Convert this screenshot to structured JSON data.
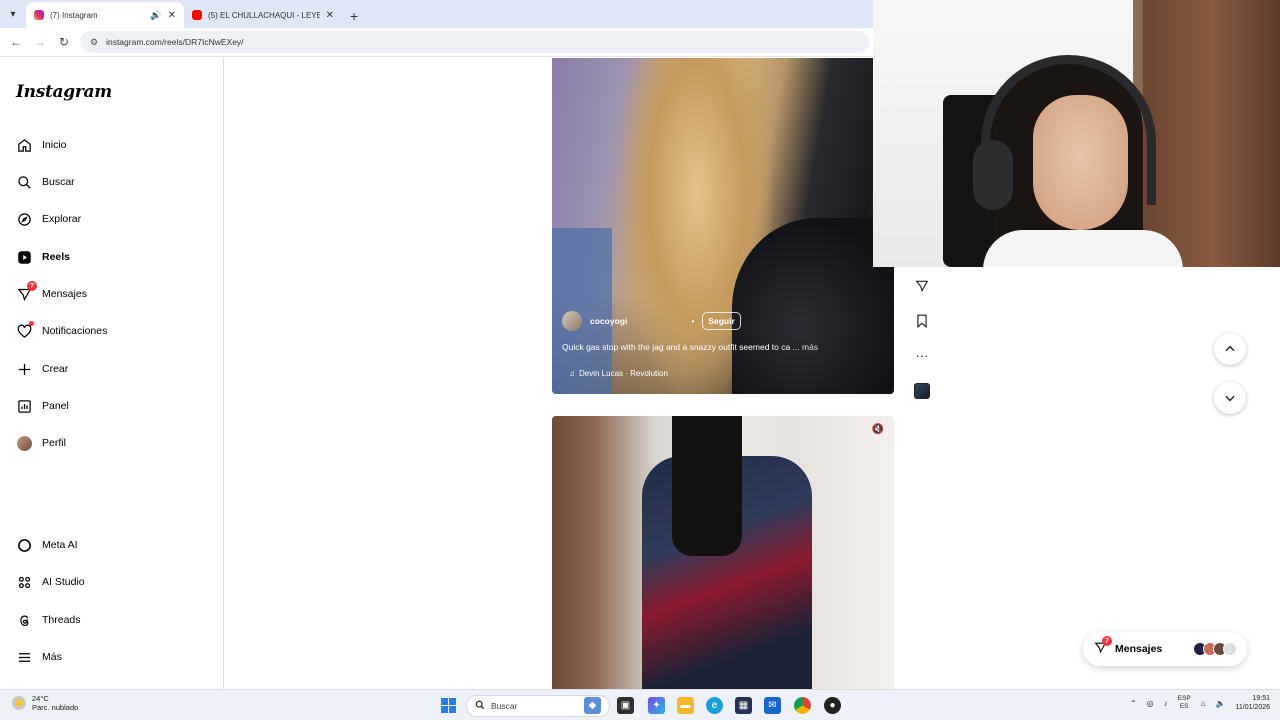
{
  "browser": {
    "tabs": [
      {
        "title": "(7) Instagram",
        "active": true
      },
      {
        "title": "(5) EL CHULLACHAQUI - LEYEN",
        "active": false
      }
    ],
    "url": "instagram.com/reels/DR7IcNwEXey/"
  },
  "sidebar": {
    "logo": "Instagram",
    "items": [
      {
        "label": "Inicio",
        "icon": "home-icon"
      },
      {
        "label": "Buscar",
        "icon": "search-icon"
      },
      {
        "label": "Explorar",
        "icon": "compass-icon"
      },
      {
        "label": "Reels",
        "icon": "reels-icon"
      },
      {
        "label": "Mensajes",
        "icon": "messenger-icon",
        "badge": "7"
      },
      {
        "label": "Notificaciones",
        "icon": "heart-icon"
      },
      {
        "label": "Crear",
        "icon": "plus-icon"
      },
      {
        "label": "Panel",
        "icon": "chart-icon"
      },
      {
        "label": "Perfil",
        "icon": "avatar-icon"
      },
      {
        "label": "Meta AI",
        "icon": "meta-ai-icon"
      },
      {
        "label": "AI Studio",
        "icon": "ai-studio-icon"
      },
      {
        "label": "Threads",
        "icon": "threads-icon"
      },
      {
        "label": "Más",
        "icon": "menu-icon"
      }
    ]
  },
  "reel": {
    "username": "cocoyogi",
    "separator": "•",
    "follow_label": "Seguir",
    "caption": "Quick gas stop with the jag and a snazzy outfit seemed to ca ...",
    "more_label": "más",
    "audio": "Devin Lucas · Revolution"
  },
  "messages_pill": {
    "label": "Mensajes",
    "badge": "7"
  },
  "taskbar": {
    "weather_temp": "24°C",
    "weather_desc": "Parc. nublado",
    "search_placeholder": "Buscar",
    "lang_top": "ESP",
    "lang_bottom": "ES",
    "time": "19:51",
    "date": "11/01/2026"
  },
  "colors": {
    "badge": "#ff3040",
    "taskbar": "#eef1f7",
    "tabbar": "#dfe7f7"
  }
}
